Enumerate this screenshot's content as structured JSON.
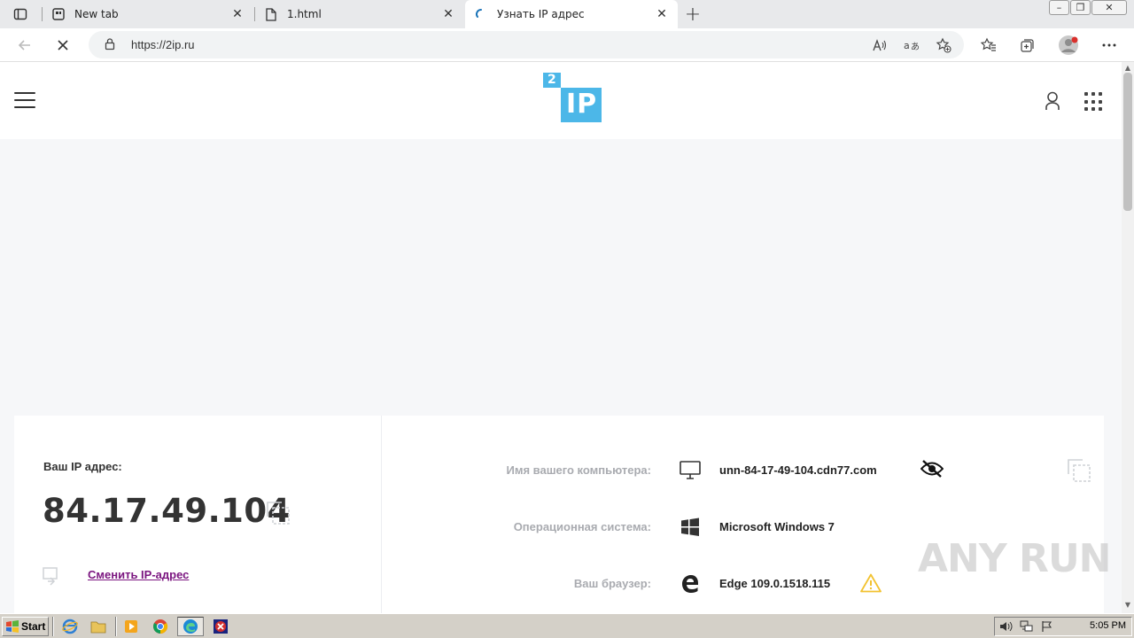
{
  "browser": {
    "tabs": [
      {
        "title": "New tab",
        "icon": "newtab-icon",
        "active": false
      },
      {
        "title": "1.html",
        "icon": "file-icon",
        "active": false
      },
      {
        "title": "Узнать IP адрес",
        "icon": "loading-icon",
        "active": true
      }
    ],
    "url": "https://2ip.ru"
  },
  "site": {
    "logo_badge": "2",
    "logo_text": "IP"
  },
  "ip_card": {
    "label": "Ваш IP адрес:",
    "ip": "84.17.49.104",
    "change_label": "Сменить IP-адрес"
  },
  "info_rows": [
    {
      "label": "Имя вашего компьютера:",
      "value": "unn-84-17-49-104.cdn77.com",
      "icon": "monitor-icon"
    },
    {
      "label": "Операционная система:",
      "value": "Microsoft Windows 7",
      "icon": "windows-icon"
    },
    {
      "label": "Ваш браузер:",
      "value": "Edge 109.0.1518.115",
      "icon": "edge-icon"
    }
  ],
  "watermark": "ANY RUN",
  "taskbar": {
    "start_label": "Start",
    "clock": "5:05 PM"
  },
  "colors": {
    "logo_blue": "#4cb7e8",
    "link_purple": "#7b1680",
    "warning_yellow": "#f2c230",
    "page_bg": "#f6f7f9"
  }
}
